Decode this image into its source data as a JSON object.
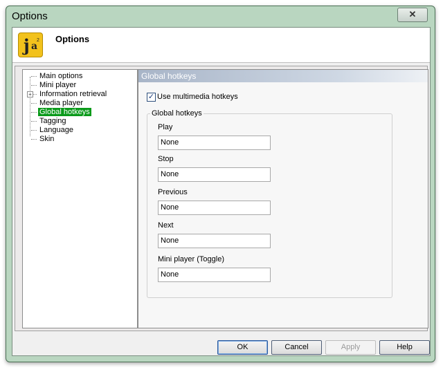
{
  "window": {
    "title": "Options",
    "close_glyph": "✕"
  },
  "header": {
    "title": "Options",
    "icon": "ja2-app-icon",
    "icon_j": "j",
    "icon_a": "a",
    "icon_sup": "2"
  },
  "tree": {
    "items": [
      {
        "label": "Main options",
        "selected": false,
        "expandable": false
      },
      {
        "label": "Mini player",
        "selected": false,
        "expandable": false
      },
      {
        "label": "Information retrieval",
        "selected": false,
        "expandable": true
      },
      {
        "label": "Media player",
        "selected": false,
        "expandable": false
      },
      {
        "label": "Global hotkeys",
        "selected": true,
        "expandable": false
      },
      {
        "label": "Tagging",
        "selected": false,
        "expandable": false
      },
      {
        "label": "Language",
        "selected": false,
        "expandable": false
      },
      {
        "label": "Skin",
        "selected": false,
        "expandable": false
      }
    ],
    "expand_glyph": "+",
    "selected_color": "#0a9a1a"
  },
  "panel": {
    "title": "Global hotkeys",
    "use_multimedia": {
      "label": "Use multimedia hotkeys",
      "checked": true,
      "check_glyph": "✓"
    },
    "group": {
      "legend": "Global hotkeys",
      "fields": [
        {
          "label": "Play",
          "value": "None"
        },
        {
          "label": "Stop",
          "value": "None"
        },
        {
          "label": "Previous",
          "value": "None"
        },
        {
          "label": "Next",
          "value": "None"
        },
        {
          "label": "Mini player (Toggle)",
          "value": "None"
        }
      ]
    }
  },
  "buttons": {
    "ok": "OK",
    "cancel": "Cancel",
    "apply": "Apply",
    "help": "Help"
  },
  "colors": {
    "window_frame": "#b9d6c0",
    "panel_header": "#a8b5c8"
  }
}
